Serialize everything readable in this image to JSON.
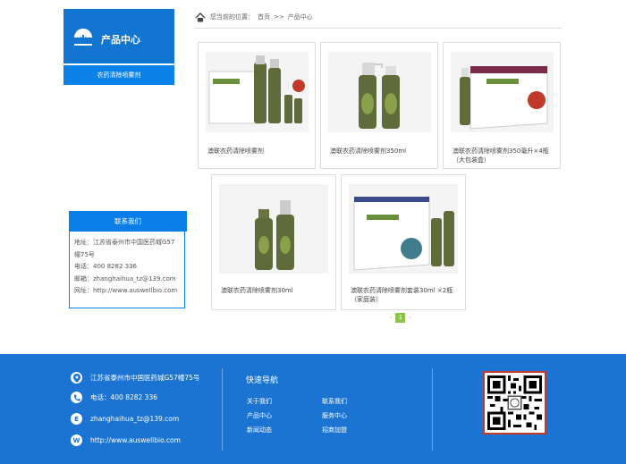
{
  "sidebar": {
    "category_title": "产品中心",
    "category_item": "农药清除喷雾剂",
    "contact_title": "联系我们",
    "contact_lines": [
      "地址：江苏省泰州市中国医药城G57",
      "幢75号",
      "电话：400 8282 336",
      "邮箱：zhanghaihua_tz@139.com",
      "网址：http://www.auswellbio.com"
    ]
  },
  "breadcrumb": {
    "prefix": "您当前的位置：",
    "home": "首页",
    "sep": ">>",
    "current": "产品中心"
  },
  "products": [
    {
      "name": "澳联农药清除喷雾剂"
    },
    {
      "name": "澳联农药清除喷雾剂350ml"
    },
    {
      "name": "澳联农药清除喷雾剂350毫升×4瓶（大包装盒）"
    },
    {
      "name": "澳联农药清除喷雾剂30ml"
    },
    {
      "name": "澳联农药清除喷雾剂套装30ml ×2瓶（家庭装）"
    }
  ],
  "pager": {
    "prev": "‹",
    "current": "1",
    "next": "›"
  },
  "footer": {
    "address": "江苏省泰州市中国医药城G57幢75号",
    "phone": "电话：400 8282 336",
    "email": "zhanghaihua_tz@139.com",
    "website": "http://www.auswellbio.com",
    "quick_nav_title": "快速导航",
    "links": [
      "关于我们",
      "联系我们",
      "产品中心",
      "服务中心",
      "新闻动态",
      "招商加盟"
    ],
    "icon_letters": {
      "email": "E",
      "web": "W"
    }
  },
  "colors": {
    "brand_blue": "#1275d2",
    "footer_blue": "#1b74d2",
    "pager_green": "#8bc34a"
  }
}
